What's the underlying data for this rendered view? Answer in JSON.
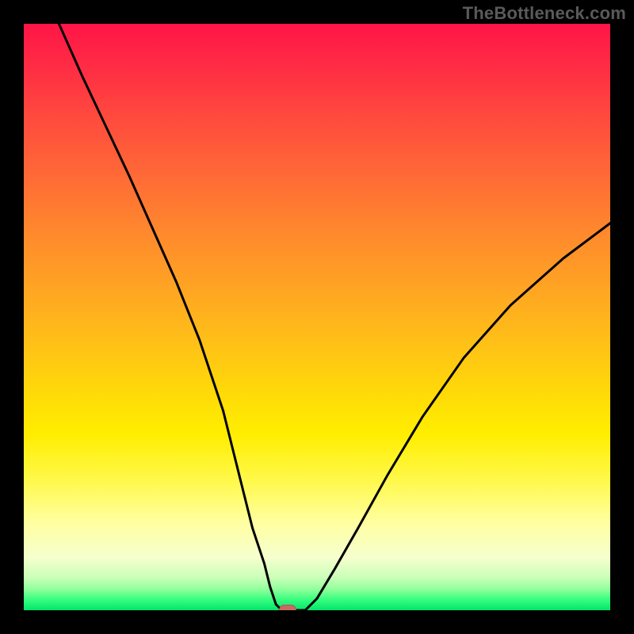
{
  "watermark": "TheBottleneck.com",
  "colors": {
    "frame": "#000000",
    "curve": "#000000",
    "marker": "#c96a63"
  },
  "chart_data": {
    "type": "line",
    "title": "",
    "xlabel": "",
    "ylabel": "",
    "xlim": [
      0,
      100
    ],
    "ylim": [
      0,
      100
    ],
    "grid": false,
    "legend": false,
    "series": [
      {
        "name": "curve",
        "x": [
          6,
          10,
          14,
          18,
          22,
          26,
          30,
          34,
          37,
          39,
          41,
          42,
          43,
          44,
          45,
          48,
          50,
          53,
          57,
          62,
          68,
          75,
          83,
          92,
          100
        ],
        "y": [
          100,
          91,
          82.5,
          74,
          65,
          56,
          46,
          34,
          22,
          14,
          8,
          4,
          1,
          0,
          0,
          0,
          2,
          7,
          14,
          23,
          33,
          43,
          52,
          60,
          66
        ]
      }
    ],
    "annotations": [
      {
        "name": "min-marker",
        "x": 45,
        "y": 0
      }
    ],
    "background_gradient": {
      "direction": "vertical",
      "stops": [
        {
          "pos": 0.0,
          "color": "#ff1547"
        },
        {
          "pos": 0.36,
          "color": "#ff8a2c"
        },
        {
          "pos": 0.63,
          "color": "#ffda08"
        },
        {
          "pos": 0.85,
          "color": "#ffffa0"
        },
        {
          "pos": 1.0,
          "color": "#00e66a"
        }
      ]
    }
  }
}
